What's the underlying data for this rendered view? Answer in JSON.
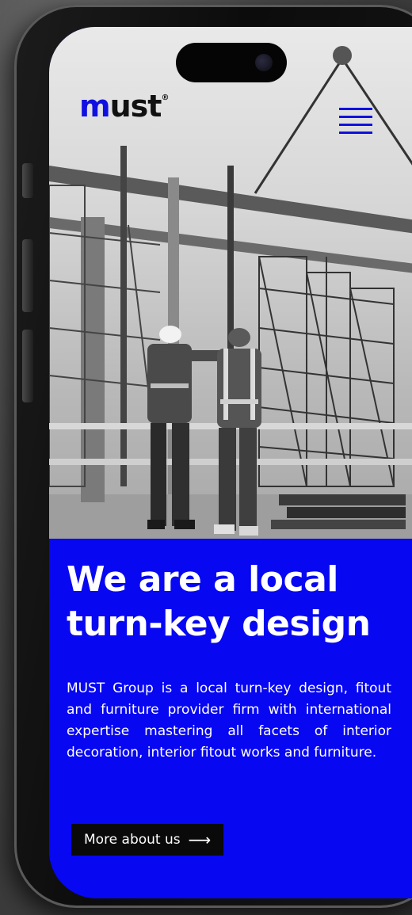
{
  "brand": {
    "logo_m": "m",
    "logo_rest": "ust",
    "logo_reg": "®",
    "accent_color": "#0707f2"
  },
  "header": {
    "menu_icon": "hamburger-menu-icon"
  },
  "hero": {
    "image": "construction-workers-scaffolding-photo"
  },
  "main": {
    "headline": "We are a local turn-key design",
    "description": "MUST Group is a local turn-key design, fitout and furniture provider firm with international expertise mastering all facets of interior decoration, interior fitout works and furniture.",
    "cta_label": "More about us",
    "cta_icon": "arrow-right-icon",
    "cta_arrow": "⟶"
  }
}
